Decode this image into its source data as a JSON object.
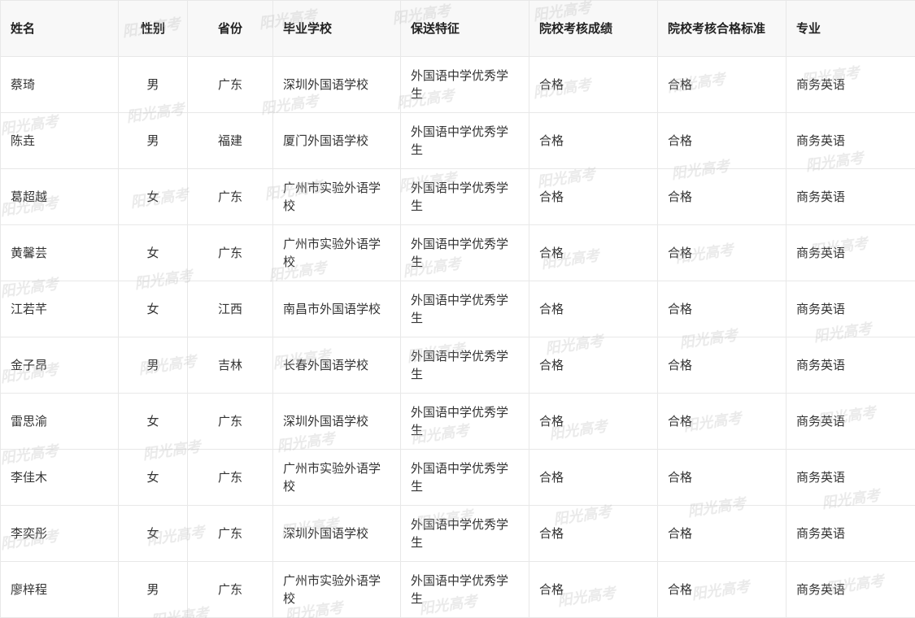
{
  "watermark_text": "阳光高考",
  "table": {
    "headers": [
      "姓名",
      "性别",
      "省份",
      "毕业学校",
      "保送特征",
      "院校考核成绩",
      "院校考核合格标准",
      "专业"
    ],
    "rows": [
      [
        "蔡琦",
        "男",
        "广东",
        "深圳外国语学校",
        "外国语中学优秀学生",
        "合格",
        "合格",
        "商务英语"
      ],
      [
        "陈垚",
        "男",
        "福建",
        "厦门外国语学校",
        "外国语中学优秀学生",
        "合格",
        "合格",
        "商务英语"
      ],
      [
        "葛超越",
        "女",
        "广东",
        "广州市实验外语学校",
        "外国语中学优秀学生",
        "合格",
        "合格",
        "商务英语"
      ],
      [
        "黄馨芸",
        "女",
        "广东",
        "广州市实验外语学校",
        "外国语中学优秀学生",
        "合格",
        "合格",
        "商务英语"
      ],
      [
        "江若芊",
        "女",
        "江西",
        "南昌市外国语学校",
        "外国语中学优秀学生",
        "合格",
        "合格",
        "商务英语"
      ],
      [
        "金子昂",
        "男",
        "吉林",
        "长春外国语学校",
        "外国语中学优秀学生",
        "合格",
        "合格",
        "商务英语"
      ],
      [
        "雷思渝",
        "女",
        "广东",
        "深圳外国语学校",
        "外国语中学优秀学生",
        "合格",
        "合格",
        "商务英语"
      ],
      [
        "李佳木",
        "女",
        "广东",
        "广州市实验外语学校",
        "外国语中学优秀学生",
        "合格",
        "合格",
        "商务英语"
      ],
      [
        "李奕彤",
        "女",
        "广东",
        "深圳外国语学校",
        "外国语中学优秀学生",
        "合格",
        "合格",
        "商务英语"
      ],
      [
        "廖梓程",
        "男",
        "广东",
        "广州市实验外语学校",
        "外国语中学优秀学生",
        "合格",
        "合格",
        "商务英语"
      ]
    ]
  }
}
